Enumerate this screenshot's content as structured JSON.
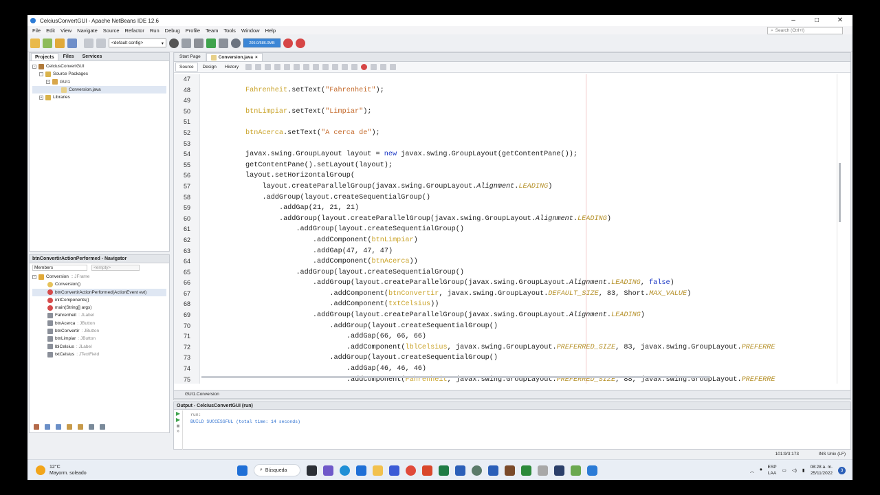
{
  "window": {
    "title": "CelciusConvertGUI - Apache NetBeans IDE 12.6",
    "minimize": "–",
    "maximize": "□",
    "close": "✕"
  },
  "menu": [
    "File",
    "Edit",
    "View",
    "Navigate",
    "Source",
    "Refactor",
    "Run",
    "Debug",
    "Profile",
    "Team",
    "Tools",
    "Window",
    "Help"
  ],
  "search": {
    "placeholder": "Search (Ctrl+I)"
  },
  "toolbar": {
    "config": "<default config>",
    "memory": "205.0/586.0MB"
  },
  "projects_panel": {
    "tabs": [
      "Projects",
      "Files",
      "Services"
    ],
    "tree": [
      "CelciusConvertGUI",
      "Source Packages",
      "GUI1",
      "Conversion.java",
      "Libraries"
    ]
  },
  "navigator": {
    "title": "btnConvertirActionPerformed - Navigator",
    "filter": "Members",
    "filter_value": "<empty>",
    "root_name": "Conversion",
    "root_type": " :: JFrame",
    "members": [
      {
        "name": "Conversion()",
        "type": ""
      },
      {
        "name": "btnConvertirActionPerformed(ActionEvent evt)",
        "type": ""
      },
      {
        "name": "initComponents()",
        "type": ""
      },
      {
        "name": "main(String[] args)",
        "type": ""
      },
      {
        "name": "Fahrenheit",
        "type": " : JLabel"
      },
      {
        "name": "btnAcerca",
        "type": " : JButton"
      },
      {
        "name": "btnConvertir",
        "type": " : JButton"
      },
      {
        "name": "btnLimpiar",
        "type": " : JButton"
      },
      {
        "name": "lblCelsius",
        "type": " : JLabel"
      },
      {
        "name": "txtCelsius",
        "type": " : JTextField"
      }
    ]
  },
  "editor": {
    "tabs": [
      "Start Page",
      "Conversion.java"
    ],
    "subtabs": [
      "Source",
      "Design",
      "History"
    ],
    "breadcrumb": "GUI1.Conversion"
  },
  "code_lines": [
    {
      "n": "47",
      "indent": 0,
      "segs": []
    },
    {
      "n": "48",
      "indent": 0,
      "segs": [
        [
          "id",
          "Fahrenheit"
        ],
        [
          "p",
          ".setText("
        ],
        [
          "str",
          "\"Fahrenheit\""
        ],
        [
          "p",
          ");"
        ]
      ]
    },
    {
      "n": "49",
      "indent": 0,
      "segs": []
    },
    {
      "n": "50",
      "indent": 0,
      "segs": [
        [
          "id",
          "btnLimpiar"
        ],
        [
          "p",
          ".setText("
        ],
        [
          "str",
          "\"Limpiar\""
        ],
        [
          "p",
          ");"
        ]
      ]
    },
    {
      "n": "51",
      "indent": 0,
      "segs": []
    },
    {
      "n": "52",
      "indent": 0,
      "segs": [
        [
          "id",
          "btnAcerca"
        ],
        [
          "p",
          ".setText("
        ],
        [
          "str",
          "\"A cerca de\""
        ],
        [
          "p",
          ");"
        ]
      ]
    },
    {
      "n": "53",
      "indent": 0,
      "segs": []
    },
    {
      "n": "54",
      "indent": 0,
      "segs": [
        [
          "p",
          "javax.swing.GroupLayout layout = "
        ],
        [
          "kw",
          "new"
        ],
        [
          "p",
          " javax.swing.GroupLayout(getContentPane());"
        ]
      ]
    },
    {
      "n": "55",
      "indent": 0,
      "segs": [
        [
          "p",
          "getContentPane().setLayout(layout);"
        ]
      ]
    },
    {
      "n": "56",
      "indent": 0,
      "segs": [
        [
          "p",
          "layout.setHorizontalGroup("
        ]
      ]
    },
    {
      "n": "57",
      "indent": 4,
      "segs": [
        [
          "p",
          "layout.createParallelGroup(javax.swing.GroupLayout."
        ],
        [
          "em",
          "Alignment"
        ],
        [
          "p",
          "."
        ],
        [
          "it",
          "LEADING"
        ],
        [
          "p",
          ")"
        ]
      ]
    },
    {
      "n": "58",
      "indent": 4,
      "segs": [
        [
          "p",
          ".addGroup(layout.createSequentialGroup()"
        ]
      ]
    },
    {
      "n": "59",
      "indent": 8,
      "segs": [
        [
          "p",
          ".addGap(21, 21, 21)"
        ]
      ]
    },
    {
      "n": "60",
      "indent": 8,
      "segs": [
        [
          "p",
          ".addGroup(layout.createParallelGroup(javax.swing.GroupLayout."
        ],
        [
          "em",
          "Alignment"
        ],
        [
          "p",
          "."
        ],
        [
          "it",
          "LEADING"
        ],
        [
          "p",
          ")"
        ]
      ]
    },
    {
      "n": "61",
      "indent": 12,
      "segs": [
        [
          "p",
          ".addGroup(layout.createSequentialGroup()"
        ]
      ]
    },
    {
      "n": "62",
      "indent": 16,
      "segs": [
        [
          "p",
          ".addComponent("
        ],
        [
          "id",
          "btnLimpiar"
        ],
        [
          "p",
          ")"
        ]
      ]
    },
    {
      "n": "63",
      "indent": 16,
      "segs": [
        [
          "p",
          ".addGap(47, 47, 47)"
        ]
      ]
    },
    {
      "n": "64",
      "indent": 16,
      "segs": [
        [
          "p",
          ".addComponent("
        ],
        [
          "id",
          "btnAcerca"
        ],
        [
          "p",
          "))"
        ]
      ]
    },
    {
      "n": "65",
      "indent": 12,
      "segs": [
        [
          "p",
          ".addGroup(layout.createSequentialGroup()"
        ]
      ]
    },
    {
      "n": "66",
      "indent": 16,
      "segs": [
        [
          "p",
          ".addGroup(layout.createParallelGroup(javax.swing.GroupLayout."
        ],
        [
          "em",
          "Alignment"
        ],
        [
          "p",
          "."
        ],
        [
          "it",
          "LEADING"
        ],
        [
          "p",
          ", "
        ],
        [
          "kw",
          "false"
        ],
        [
          "p",
          ")"
        ]
      ]
    },
    {
      "n": "67",
      "indent": 20,
      "segs": [
        [
          "p",
          ".addComponent("
        ],
        [
          "id",
          "btnConvertir"
        ],
        [
          "p",
          ", javax.swing.GroupLayout."
        ],
        [
          "it",
          "DEFAULT_SIZE"
        ],
        [
          "p",
          ", 83, Short."
        ],
        [
          "it",
          "MAX_VALUE"
        ],
        [
          "p",
          ")"
        ]
      ]
    },
    {
      "n": "68",
      "indent": 20,
      "segs": [
        [
          "p",
          ".addComponent("
        ],
        [
          "id",
          "txtCelsius"
        ],
        [
          "p",
          "))"
        ]
      ]
    },
    {
      "n": "69",
      "indent": 16,
      "segs": [
        [
          "p",
          ".addGroup(layout.createParallelGroup(javax.swing.GroupLayout."
        ],
        [
          "em",
          "Alignment"
        ],
        [
          "p",
          "."
        ],
        [
          "it",
          "LEADING"
        ],
        [
          "p",
          ")"
        ]
      ]
    },
    {
      "n": "70",
      "indent": 20,
      "segs": [
        [
          "p",
          ".addGroup(layout.createSequentialGroup()"
        ]
      ]
    },
    {
      "n": "71",
      "indent": 24,
      "segs": [
        [
          "p",
          ".addGap(66, 66, 66)"
        ]
      ]
    },
    {
      "n": "72",
      "indent": 24,
      "segs": [
        [
          "p",
          ".addComponent("
        ],
        [
          "id",
          "lblCelsius"
        ],
        [
          "p",
          ", javax.swing.GroupLayout."
        ],
        [
          "it",
          "PREFERRED_SIZE"
        ],
        [
          "p",
          ", 83, javax.swing.GroupLayout."
        ],
        [
          "it",
          "PREFERRE"
        ]
      ]
    },
    {
      "n": "73",
      "indent": 20,
      "segs": [
        [
          "p",
          ".addGroup(layout.createSequentialGroup()"
        ]
      ]
    },
    {
      "n": "74",
      "indent": 24,
      "segs": [
        [
          "p",
          ".addGap(46, 46, 46)"
        ]
      ]
    },
    {
      "n": "75",
      "indent": 24,
      "segs": [
        [
          "p",
          ".addComponent("
        ],
        [
          "id",
          "Fahrenheit"
        ],
        [
          "p",
          ", javax.swing.GroupLayout."
        ],
        [
          "it",
          "PREFERRED_SIZE"
        ],
        [
          "p",
          ", 88, javax.swing.GroupLayout."
        ],
        [
          "it",
          "PREFERRE"
        ]
      ]
    }
  ],
  "output": {
    "title": "Output - CelciusConvertGUI (run)",
    "lines": [
      "run:",
      "BUILD SUCCESSFUL (total time: 14 seconds)"
    ]
  },
  "status": {
    "position": "101:9/3:173",
    "mode": "INS Unix (LF)"
  },
  "taskbar": {
    "temp": "12°C",
    "weather": "Mayorm. soleado",
    "search": "Búsqueda",
    "lang1": "ESP",
    "lang2": "LAA",
    "time": "08:28 a. m.",
    "date": "25/11/2022",
    "notif": "3"
  }
}
